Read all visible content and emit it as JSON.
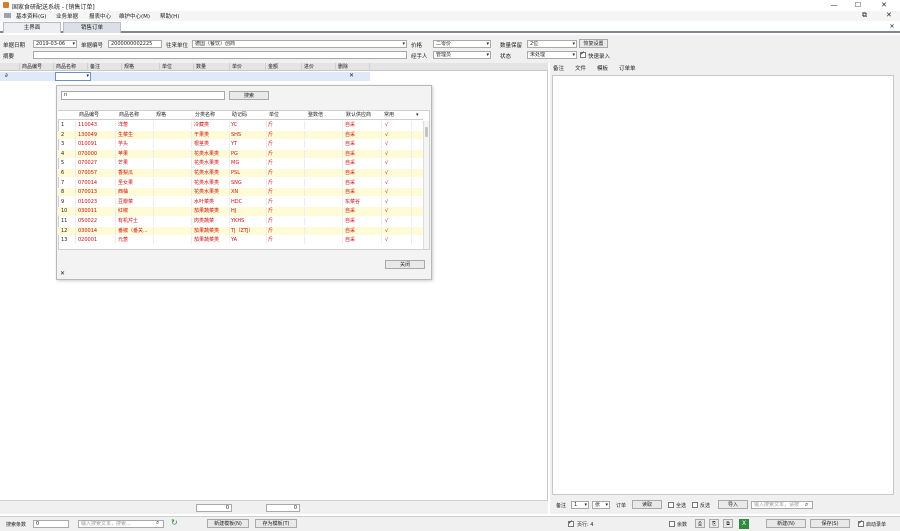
{
  "window": {
    "title": "国家食研配送系统 - [销售订单]",
    "controls": {
      "minimize": "—",
      "maximize": "☐",
      "close": "✕"
    }
  },
  "menu": [
    "基本资料(G)",
    "业务单据",
    "报表中心",
    "维护中心(M)",
    "帮助(H)"
  ],
  "tabs": [
    {
      "label": "主界面"
    },
    {
      "label": "销售订单"
    }
  ],
  "form": {
    "date_label": "单据日期",
    "date_value": "2019-03-06",
    "doc_no_label": "单据编号",
    "doc_no_value": "2000000002225",
    "customer_label": "往来单位",
    "customer_value": "德国（餐饮）创商",
    "price_label": "价格",
    "price_value": "二零价",
    "quantity_label": "数量保留",
    "quantity_value": "2位",
    "reset_button": "恢复设置",
    "summary_label": "摘要",
    "handler_label": "经手人",
    "handler_value": "管理员",
    "status_label": "状态",
    "status_value": "未处理",
    "quick_entry_label": "快速录入"
  },
  "grid": {
    "columns": [
      "商品编号",
      "商品名称",
      "备注",
      "规格",
      "单位",
      "数量",
      "单价",
      "金额",
      "进价",
      "删除"
    ],
    "first_row_marker": "∂",
    "name_cell_value": ""
  },
  "right_panel": {
    "tabs": [
      "备注",
      "文件",
      "模板",
      "订单单"
    ]
  },
  "popup": {
    "search_value": "n",
    "search_button": "搜索",
    "columns": [
      "商品编号",
      "商品名称",
      "规格",
      "分类名称",
      "助记码",
      "单位",
      "整数倍",
      "默认供应商",
      "常用"
    ],
    "rows": [
      {
        "idx": "1",
        "code": "110043",
        "name": "洋葱",
        "spec": "",
        "cat": "冷藏类",
        "mnem": "YC",
        "unit": "斤",
        "multi": "",
        "supplier": "自采",
        "common": "√"
      },
      {
        "idx": "2",
        "code": "130049",
        "name": "生菜生",
        "spec": "",
        "cat": "干果类",
        "mnem": "SHS",
        "unit": "斤",
        "multi": "",
        "supplier": "自采",
        "common": "√"
      },
      {
        "idx": "3",
        "code": "010091",
        "name": "芋头",
        "spec": "",
        "cat": "根茎类",
        "mnem": "YT",
        "unit": "斤",
        "multi": "",
        "supplier": "自采",
        "common": "√"
      },
      {
        "idx": "4",
        "code": "070000",
        "name": "苹果",
        "spec": "",
        "cat": "花类水果类",
        "mnem": "PG",
        "unit": "斤",
        "multi": "",
        "supplier": "自采",
        "common": "√"
      },
      {
        "idx": "5",
        "code": "070027",
        "name": "芒果",
        "spec": "",
        "cat": "花类水果类",
        "mnem": "MG",
        "unit": "斤",
        "multi": "",
        "supplier": "自采",
        "common": "√"
      },
      {
        "idx": "6",
        "code": "070057",
        "name": "香梨瓜",
        "spec": "",
        "cat": "花类水果类",
        "mnem": "PSL",
        "unit": "斤",
        "multi": "",
        "supplier": "自采",
        "common": "√"
      },
      {
        "idx": "7",
        "code": "070014",
        "name": "圣女果",
        "spec": "",
        "cat": "花类水果类",
        "mnem": "SNG",
        "unit": "斤",
        "multi": "",
        "supplier": "自采",
        "common": "√"
      },
      {
        "idx": "8",
        "code": "070013",
        "name": "西柚",
        "spec": "",
        "cat": "花类水果类",
        "mnem": "XN",
        "unit": "斤",
        "multi": "",
        "supplier": "自采",
        "common": "√"
      },
      {
        "idx": "9",
        "code": "010023",
        "name": "豆瓣菜",
        "spec": "",
        "cat": "水叶菜类",
        "mnem": "HDC",
        "unit": "斤",
        "multi": "",
        "supplier": "东菜谷",
        "common": "√"
      },
      {
        "idx": "10",
        "code": "030011",
        "name": "红椒",
        "spec": "",
        "cat": "茄果蔬菜类",
        "mnem": "HJ",
        "unit": "斤",
        "multi": "",
        "supplier": "自采",
        "common": "√"
      },
      {
        "idx": "11",
        "code": "050022",
        "name": "有机芹士",
        "spec": "",
        "cat": "肉类蔬菜",
        "mnem": "YKHS",
        "unit": "斤",
        "multi": "",
        "supplier": "自采",
        "common": "√"
      },
      {
        "idx": "12",
        "code": "030014",
        "name": "番椒（番关...",
        "spec": "",
        "cat": "茄果蔬菜类",
        "mnem": "TJ（ZTJ）",
        "unit": "斤",
        "multi": "",
        "supplier": "自采",
        "common": "√"
      },
      {
        "idx": "13",
        "code": "020001",
        "name": "元葱",
        "spec": "",
        "cat": "茄果蔬菜类",
        "mnem": "YA",
        "unit": "斤",
        "multi": "",
        "supplier": "自采",
        "common": "√"
      }
    ],
    "close_button": "关闭",
    "close_icon_label": "✕"
  },
  "totals": {
    "qty": "0",
    "amount": "0"
  },
  "right_bottom": {
    "label_remark": "备注",
    "page_value": "1",
    "unit_value": "张",
    "order_label": "订单",
    "read_button": "读取",
    "all_label": "全选",
    "invert_label": "反选",
    "import_button": "导入",
    "import_placeholder": "输入搜索文本，请按",
    "rows_label": "页行: 4"
  },
  "bottom": {
    "count_label": "搜索条数",
    "count_value": "0",
    "search_placeholder": "输入搜索文本，搜索...",
    "new_template_button": "新建模板(N)",
    "save_template_button": "存为模板(T)",
    "label_sum": "余数",
    "new_button": "新建(N)",
    "save_button": "保存(S)",
    "confirm_label": "启动录单"
  }
}
